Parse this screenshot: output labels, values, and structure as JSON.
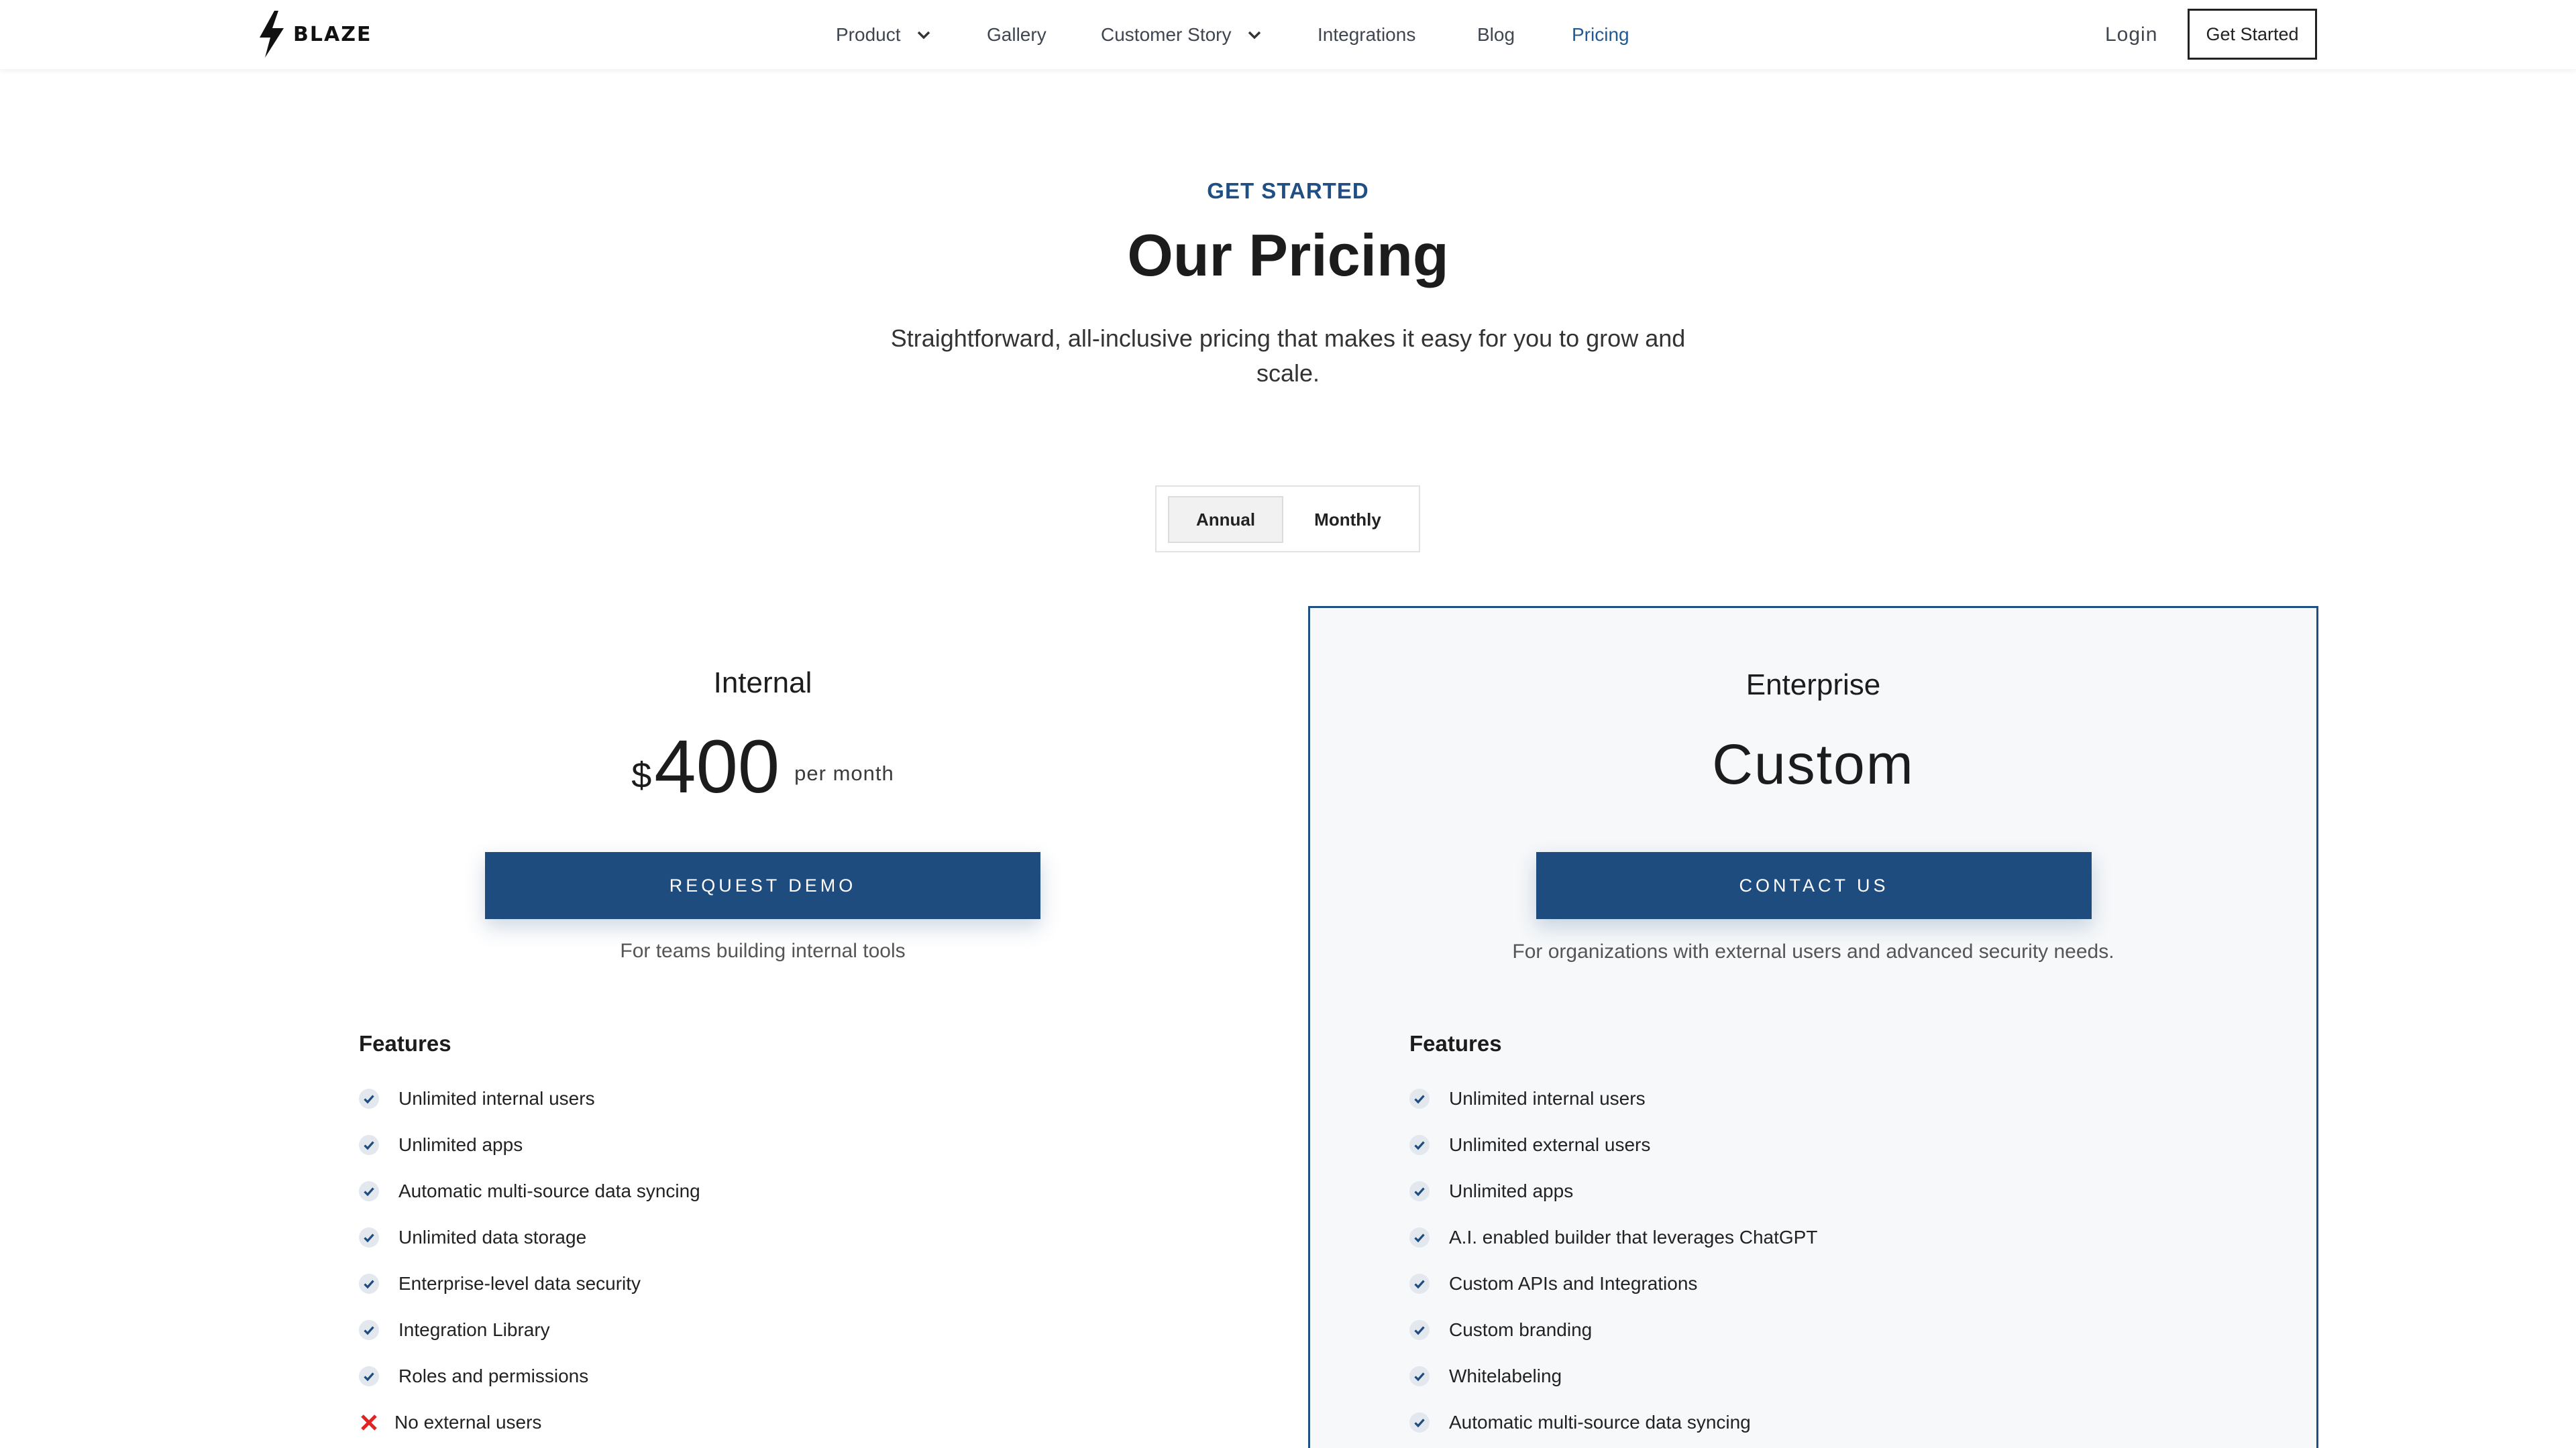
{
  "nav": {
    "logo_text": "BLAZE",
    "items": [
      {
        "label": "Product",
        "dropdown": true
      },
      {
        "label": "Gallery",
        "dropdown": false
      },
      {
        "label": "Customer Story",
        "dropdown": true
      },
      {
        "label": "Integrations",
        "dropdown": false
      },
      {
        "label": "Blog",
        "dropdown": false
      },
      {
        "label": "Pricing",
        "dropdown": false,
        "active": true
      }
    ],
    "login_label": "Login",
    "cta_label": "Get Started"
  },
  "hero": {
    "eyebrow": "GET STARTED",
    "title": "Our Pricing",
    "subtitle": "Straightforward, all-inclusive pricing that makes it easy for you to grow and scale."
  },
  "billing_toggle": {
    "options": [
      "Annual",
      "Monthly"
    ],
    "selected": "Annual"
  },
  "plans": [
    {
      "name": "Internal",
      "currency": "$",
      "price": "400",
      "period": "per month",
      "cta_label": "REQUEST DEMO",
      "tagline": "For teams building internal tools",
      "features_heading": "Features",
      "features": [
        {
          "label": "Unlimited internal users",
          "included": true
        },
        {
          "label": "Unlimited apps",
          "included": true
        },
        {
          "label": "Automatic multi-source data syncing",
          "included": true
        },
        {
          "label": "Unlimited data storage",
          "included": true
        },
        {
          "label": "Enterprise-level data security",
          "included": true
        },
        {
          "label": "Integration Library",
          "included": true
        },
        {
          "label": "Roles and permissions",
          "included": true
        },
        {
          "label": "No external users",
          "included": false
        }
      ]
    },
    {
      "name": "Enterprise",
      "price_label": "Custom",
      "cta_label": "CONTACT US",
      "tagline": "For organizations with external users and advanced security needs.",
      "features_heading": "Features",
      "highlighted": true,
      "features": [
        {
          "label": "Unlimited internal users",
          "included": true
        },
        {
          "label": "Unlimited external users",
          "included": true
        },
        {
          "label": "Unlimited apps",
          "included": true
        },
        {
          "label": "A.I. enabled builder that leverages ChatGPT",
          "included": true
        },
        {
          "label": "Custom APIs and Integrations",
          "included": true
        },
        {
          "label": "Custom branding",
          "included": true
        },
        {
          "label": "Whitelabeling",
          "included": true
        },
        {
          "label": "Automatic multi-source data syncing",
          "included": true
        }
      ]
    }
  ],
  "colors": {
    "accent": "#1f4c7f",
    "accent_text": "#1f4f85",
    "check_bg": "#e3e8ee",
    "cross": "#e02424",
    "enterprise_bg": "#f6f8fa"
  },
  "icons": {
    "logo": "lightning-bolt-icon",
    "dropdown": "chevron-down-icon",
    "included": "check-icon",
    "excluded": "cross-icon"
  }
}
